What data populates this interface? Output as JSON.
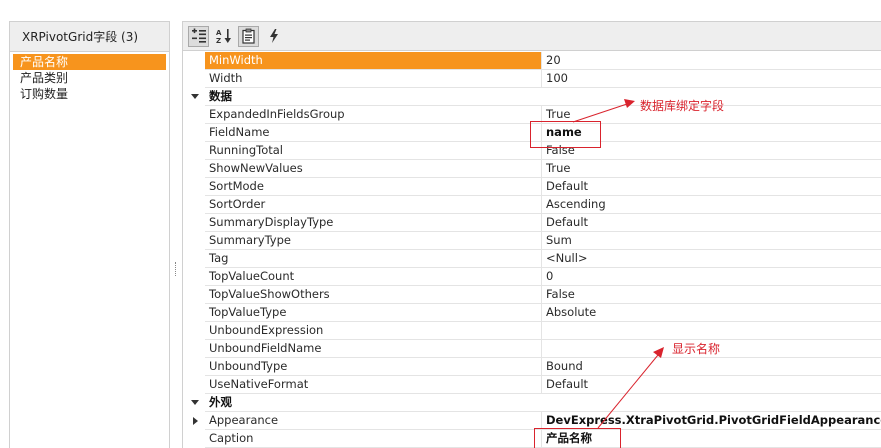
{
  "field_list": {
    "title": "XRPivotGrid字段 (3)",
    "items": [
      {
        "label": "产品名称",
        "selected": true
      },
      {
        "label": "产品类别",
        "selected": false
      },
      {
        "label": "订购数量",
        "selected": false
      }
    ]
  },
  "toolbar": {
    "buttons": [
      {
        "icon": "categorized-icon",
        "active": true
      },
      {
        "icon": "sort-alphabetical-icon",
        "active": false
      },
      {
        "icon": "properties-icon",
        "active": true
      },
      {
        "icon": "events-lightning-icon",
        "active": false
      }
    ]
  },
  "properties": {
    "rows": [
      {
        "kind": "prop",
        "name": "MinWidth",
        "value": "20",
        "selected": true
      },
      {
        "kind": "prop",
        "name": "Width",
        "value": "100"
      },
      {
        "kind": "category",
        "name": "数据"
      },
      {
        "kind": "prop",
        "name": "ExpandedInFieldsGroup",
        "value": "True"
      },
      {
        "kind": "prop",
        "name": "FieldName",
        "value": "name",
        "bold": true
      },
      {
        "kind": "prop",
        "name": "RunningTotal",
        "value": "False"
      },
      {
        "kind": "prop",
        "name": "ShowNewValues",
        "value": "True"
      },
      {
        "kind": "prop",
        "name": "SortMode",
        "value": "Default"
      },
      {
        "kind": "prop",
        "name": "SortOrder",
        "value": "Ascending"
      },
      {
        "kind": "prop",
        "name": "SummaryDisplayType",
        "value": "Default"
      },
      {
        "kind": "prop",
        "name": "SummaryType",
        "value": "Sum"
      },
      {
        "kind": "prop",
        "name": "Tag",
        "value": "<Null>"
      },
      {
        "kind": "prop",
        "name": "TopValueCount",
        "value": "0"
      },
      {
        "kind": "prop",
        "name": "TopValueShowOthers",
        "value": "False"
      },
      {
        "kind": "prop",
        "name": "TopValueType",
        "value": "Absolute"
      },
      {
        "kind": "prop",
        "name": "UnboundExpression",
        "value": ""
      },
      {
        "kind": "prop",
        "name": "UnboundFieldName",
        "value": ""
      },
      {
        "kind": "prop",
        "name": "UnboundType",
        "value": "Bound"
      },
      {
        "kind": "prop",
        "name": "UseNativeFormat",
        "value": "Default"
      },
      {
        "kind": "category",
        "name": "外观"
      },
      {
        "kind": "prop",
        "name": "Appearance",
        "value": "DevExpress.XtraPivotGrid.PivotGridFieldAppearances",
        "bold": true,
        "expandable": true
      },
      {
        "kind": "prop",
        "name": "Caption",
        "value": "产品名称",
        "bold": true
      }
    ]
  },
  "annotations": {
    "fieldname_note": "数据库绑定字段",
    "caption_note": "显示名称",
    "color": "#d9232d"
  },
  "colors": {
    "selection": "#f7941d",
    "panel_header": "#eeeeee",
    "grid_line": "#e4e4e4"
  }
}
